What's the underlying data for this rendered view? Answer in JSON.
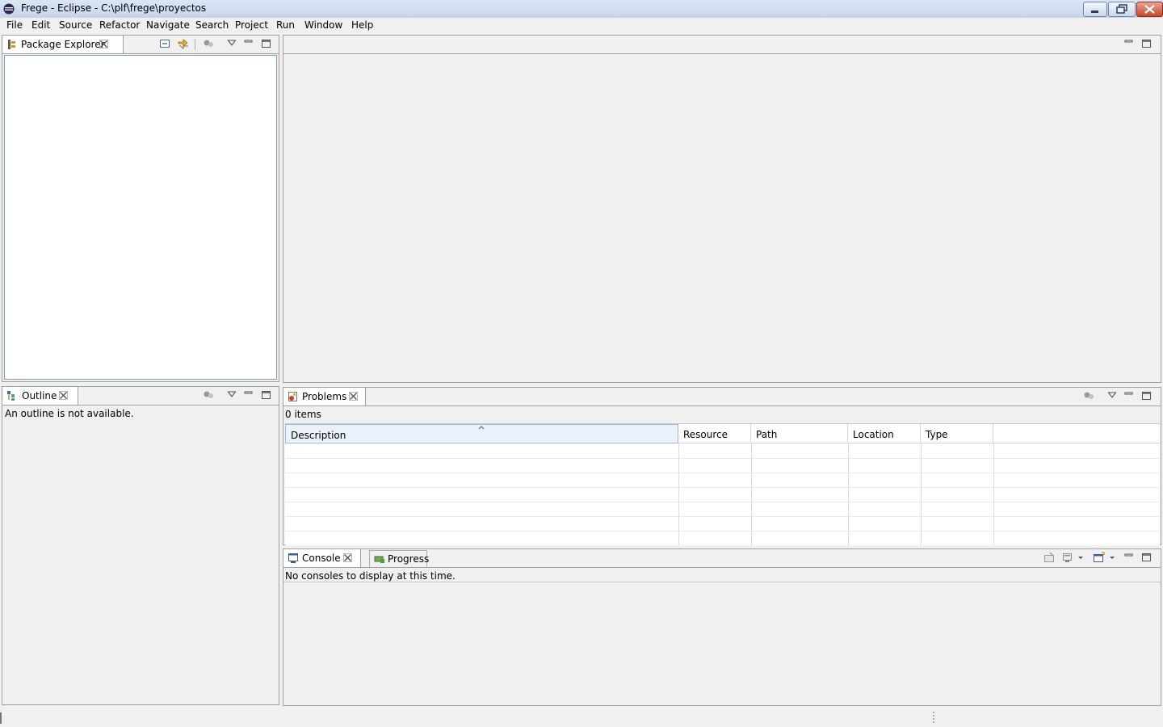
{
  "window": {
    "title": "Frege - Eclipse - C:\\plf\\frege\\proyectos"
  },
  "menu": [
    "File",
    "Edit",
    "Source",
    "Refactor",
    "Navigate",
    "Search",
    "Project",
    "Run",
    "Window",
    "Help"
  ],
  "package_explorer": {
    "tab_label": "Package Explorer"
  },
  "outline": {
    "tab_label": "Outline",
    "message": "An outline is not available."
  },
  "problems": {
    "tab_label": "Problems",
    "count": "0 items",
    "columns": [
      "Description",
      "Resource",
      "Path",
      "Location",
      "Type"
    ]
  },
  "console": {
    "tab_label": "Console",
    "progress_tab_label": "Progress",
    "message": "No consoles to display at this time."
  }
}
